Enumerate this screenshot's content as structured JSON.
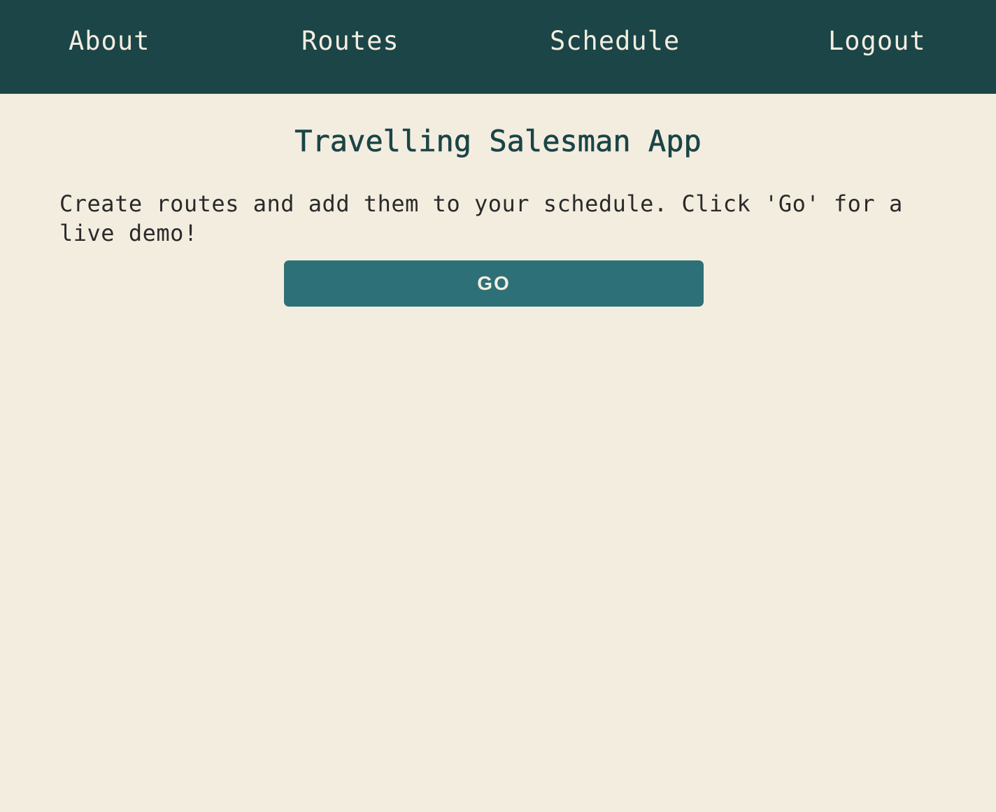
{
  "nav": {
    "about": "About",
    "routes": "Routes",
    "schedule": "Schedule",
    "logout": "Logout"
  },
  "main": {
    "title": "Travelling Salesman App",
    "intro": "Create routes and add them to your schedule. Click 'Go' for a live demo!",
    "go_label": "GO"
  },
  "colors": {
    "navbar": "#1b4547",
    "background": "#f3ede0",
    "button": "#2e7077"
  }
}
